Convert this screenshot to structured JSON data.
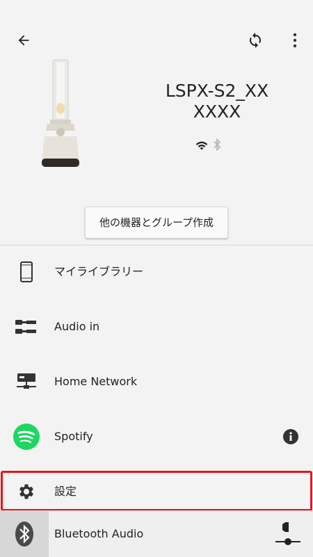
{
  "header": {
    "device_name": "LSPX-S2_XXXXXX",
    "group_button_label": "他の機器とグループ作成"
  },
  "menu": {
    "items": [
      {
        "label": "マイライブラリー",
        "icon": "smartphone-icon"
      },
      {
        "label": "Audio in",
        "icon": "audio-cable-icon"
      },
      {
        "label": "Home Network",
        "icon": "home-network-icon"
      },
      {
        "label": "Spotify",
        "icon": "spotify-icon"
      },
      {
        "label": "設定",
        "icon": "gear-icon"
      }
    ]
  },
  "footer": {
    "source_label": "Bluetooth Audio"
  },
  "colors": {
    "highlight": "#e8141b",
    "spotify": "#1ed760"
  }
}
